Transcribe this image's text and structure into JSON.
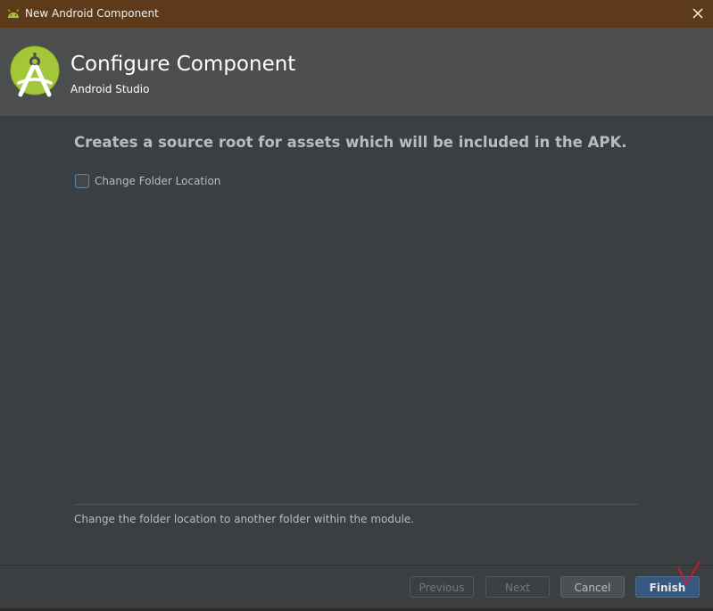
{
  "window": {
    "title": "New Android Component"
  },
  "header": {
    "title": "Configure Component",
    "subtitle": "Android Studio"
  },
  "content": {
    "headline": "Creates a source root for assets which will be included in the APK.",
    "change_folder_checkbox": {
      "label": "Change Folder Location",
      "checked": false
    },
    "description": "Change the folder location to another folder within the module."
  },
  "buttons": {
    "previous": "Previous",
    "next": "Next",
    "cancel": "Cancel",
    "finish": "Finish"
  },
  "colors": {
    "title_bar": "#5d3a1a",
    "header_bg": "#4b4d4f",
    "body_bg": "#3c3f41",
    "android_green": "#a4c639",
    "primary_button": "#365880",
    "annotation_mark": "#d11a2a"
  },
  "icons": {
    "window_icon": "android-robot-icon",
    "logo": "android-studio-logo",
    "close": "close-icon",
    "annotation": "checkmark-annotation-icon"
  }
}
